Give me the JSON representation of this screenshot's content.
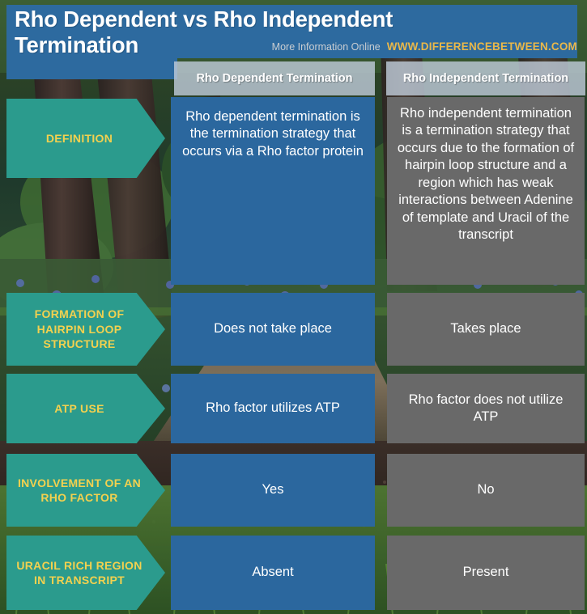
{
  "header": {
    "title": "Rho Dependent vs Rho Independent Termination",
    "more_info_label": "More Information Online",
    "site_url": "WWW.DIFFERENCEBETWEEN.COM"
  },
  "columns": [
    {
      "key": "dependent",
      "label": "Rho Dependent Termination"
    },
    {
      "key": "independent",
      "label": "Rho Independent Termination"
    }
  ],
  "rows": [
    {
      "label": "DEFINITION",
      "dependent": "Rho dependent termination is the termination strategy that occurs via a Rho factor protein",
      "independent": "Rho independent termination is a termination strategy that occurs due to the formation of hairpin loop structure and a region which has weak interactions between Adenine of template and Uracil of the transcript"
    },
    {
      "label": "FORMATION OF HAIRPIN LOOP STRUCTURE",
      "dependent": "Does not take place",
      "independent": "Takes place"
    },
    {
      "label": "ATP USE",
      "dependent": "Rho factor utilizes ATP",
      "independent": "Rho factor does not utilize ATP"
    },
    {
      "label": "INVOLVEMENT OF AN RHO FACTOR",
      "dependent": "Yes",
      "independent": "No"
    },
    {
      "label": "URACIL RICH REGION IN TRANSCRIPT",
      "dependent": "Absent",
      "independent": "Present"
    }
  ],
  "colors": {
    "banner_blue": "#2d6a9f",
    "column_blue": "#2b679e",
    "column_gray": "#696969",
    "label_teal": "#2b9b8d",
    "label_yellow": "#f3d14f",
    "url_gold": "#e9b84a",
    "column_header_bar": "#bdcbd8"
  }
}
